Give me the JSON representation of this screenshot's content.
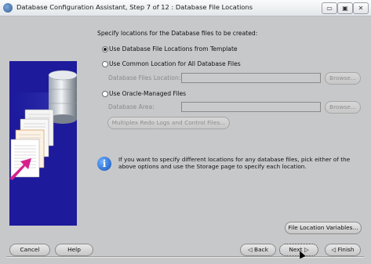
{
  "window": {
    "title": "Database Configuration Assistant, Step 7 of 12 : Database File Locations",
    "minimize_glyph": "▭",
    "maximize_glyph": "▣",
    "close_glyph": "✕"
  },
  "content": {
    "heading": "Specify locations for the Database files to be created:",
    "options": {
      "template": {
        "label": "Use Database File Locations from Template",
        "selected": true
      },
      "common": {
        "label": "Use Common Location for All Database Files",
        "selected": false,
        "field_label": "Database Files Location:",
        "field_value": "",
        "browse_label": "Browse..."
      },
      "omf": {
        "label": "Use Oracle-Managed Files",
        "selected": false,
        "field_label": "Database Area:",
        "field_value": "",
        "browse_label": "Browse...",
        "multiplex_label": "Multiplex Redo Logs and Control Files..."
      }
    },
    "info_text": "If you want to specify different locations for any database files, pick either of the above options and use the Storage page to specify each location.",
    "file_location_variables_label": "File Location Variables..."
  },
  "footer": {
    "cancel_label": "Cancel",
    "help_label": "Help",
    "back_label": "Back",
    "next_label": "Next",
    "finish_label": "Finish",
    "back_arrow": "◁",
    "next_arrow": "▷",
    "finish_arrow": "◁"
  },
  "colors": {
    "panel_bg": "#1d1a9c",
    "window_bg": "#c7c8ca"
  },
  "icons": {
    "app": "dbca-app-icon",
    "info": "info-icon",
    "illustration": "database-files-illustration"
  }
}
